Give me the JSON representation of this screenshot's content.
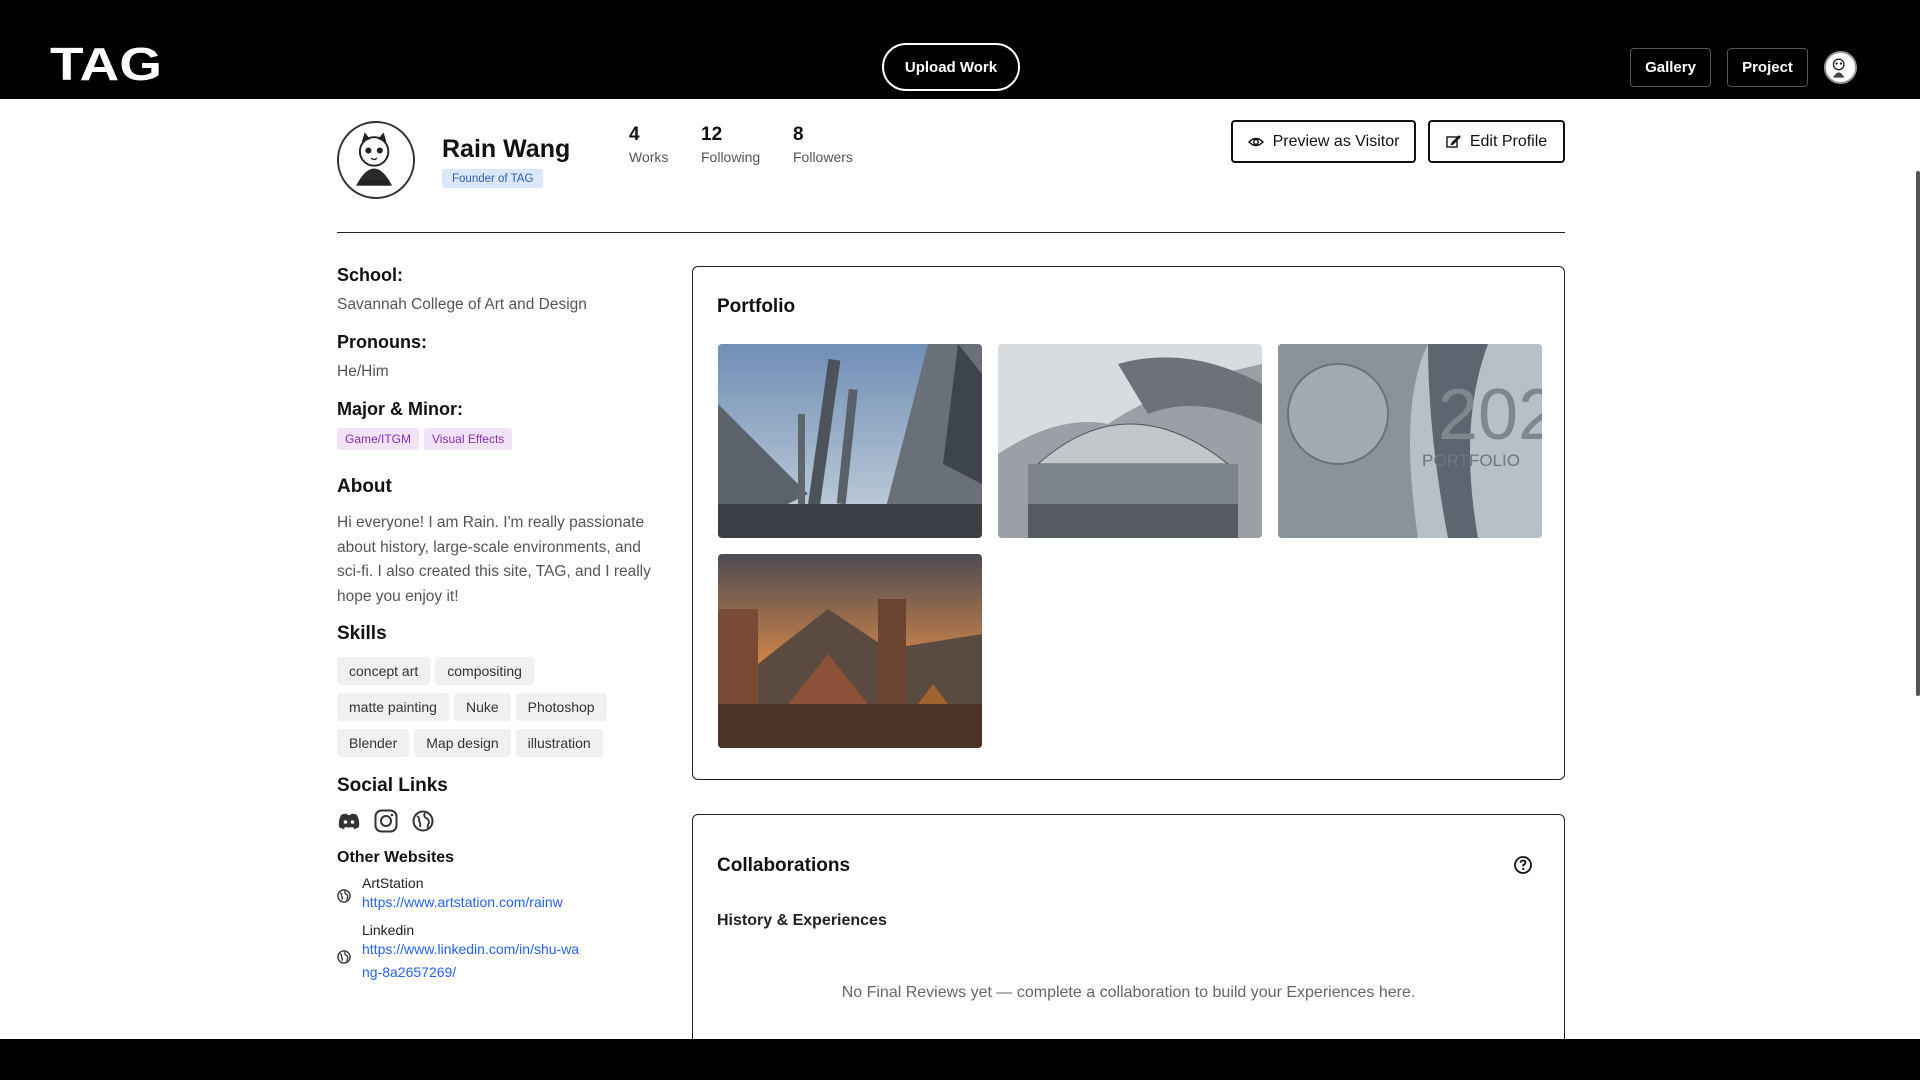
{
  "nav": {
    "logo_text": "TAG",
    "upload_label": "Upload Work",
    "gallery_label": "Gallery",
    "project_label": "Project"
  },
  "profile": {
    "name": "Rain Wang",
    "badge": "Founder of TAG",
    "stats": [
      {
        "value": "4",
        "label": "Works"
      },
      {
        "value": "12",
        "label": "Following"
      },
      {
        "value": "8",
        "label": "Followers"
      }
    ],
    "preview_label": "Preview as Visitor",
    "edit_label": "Edit Profile"
  },
  "info": {
    "school_label": "School:",
    "school": "Savannah College of Art and Design",
    "pronouns_label": "Pronouns:",
    "pronouns": "He/Him",
    "major_label": "Major & Minor:",
    "majors": [
      "Game/ITGM",
      "Visual Effects"
    ],
    "about_title": "About",
    "about": "Hi everyone! I am Rain. I'm really passionate about history, large-scale environments, and sci-fi. I also created this site, TAG, and I really hope you enjoy it!",
    "skills_title": "Skills",
    "skills": [
      "concept art",
      "compositing",
      "matte painting",
      "Nuke",
      "Photoshop",
      "Blender",
      "Map design",
      "illustration"
    ],
    "social_title": "Social Links",
    "social_icons": [
      "discord-icon",
      "instagram-icon",
      "globe-icon"
    ],
    "other_title": "Other Websites",
    "websites": [
      {
        "name": "ArtStation",
        "url": "https://www.artstation.com/rainw"
      },
      {
        "name": "Linkedin",
        "url": "https://www.linkedin.com/in/shu-wang-8a2657269/"
      }
    ]
  },
  "portfolio": {
    "title": "Portfolio",
    "thumb_text": {
      "big": "202",
      "small": "PORTFOLIO"
    }
  },
  "collab": {
    "title": "Collaborations",
    "subtitle": "History & Experiences",
    "empty": "No Final Reviews yet — complete a collaboration to build your Experiences here."
  }
}
